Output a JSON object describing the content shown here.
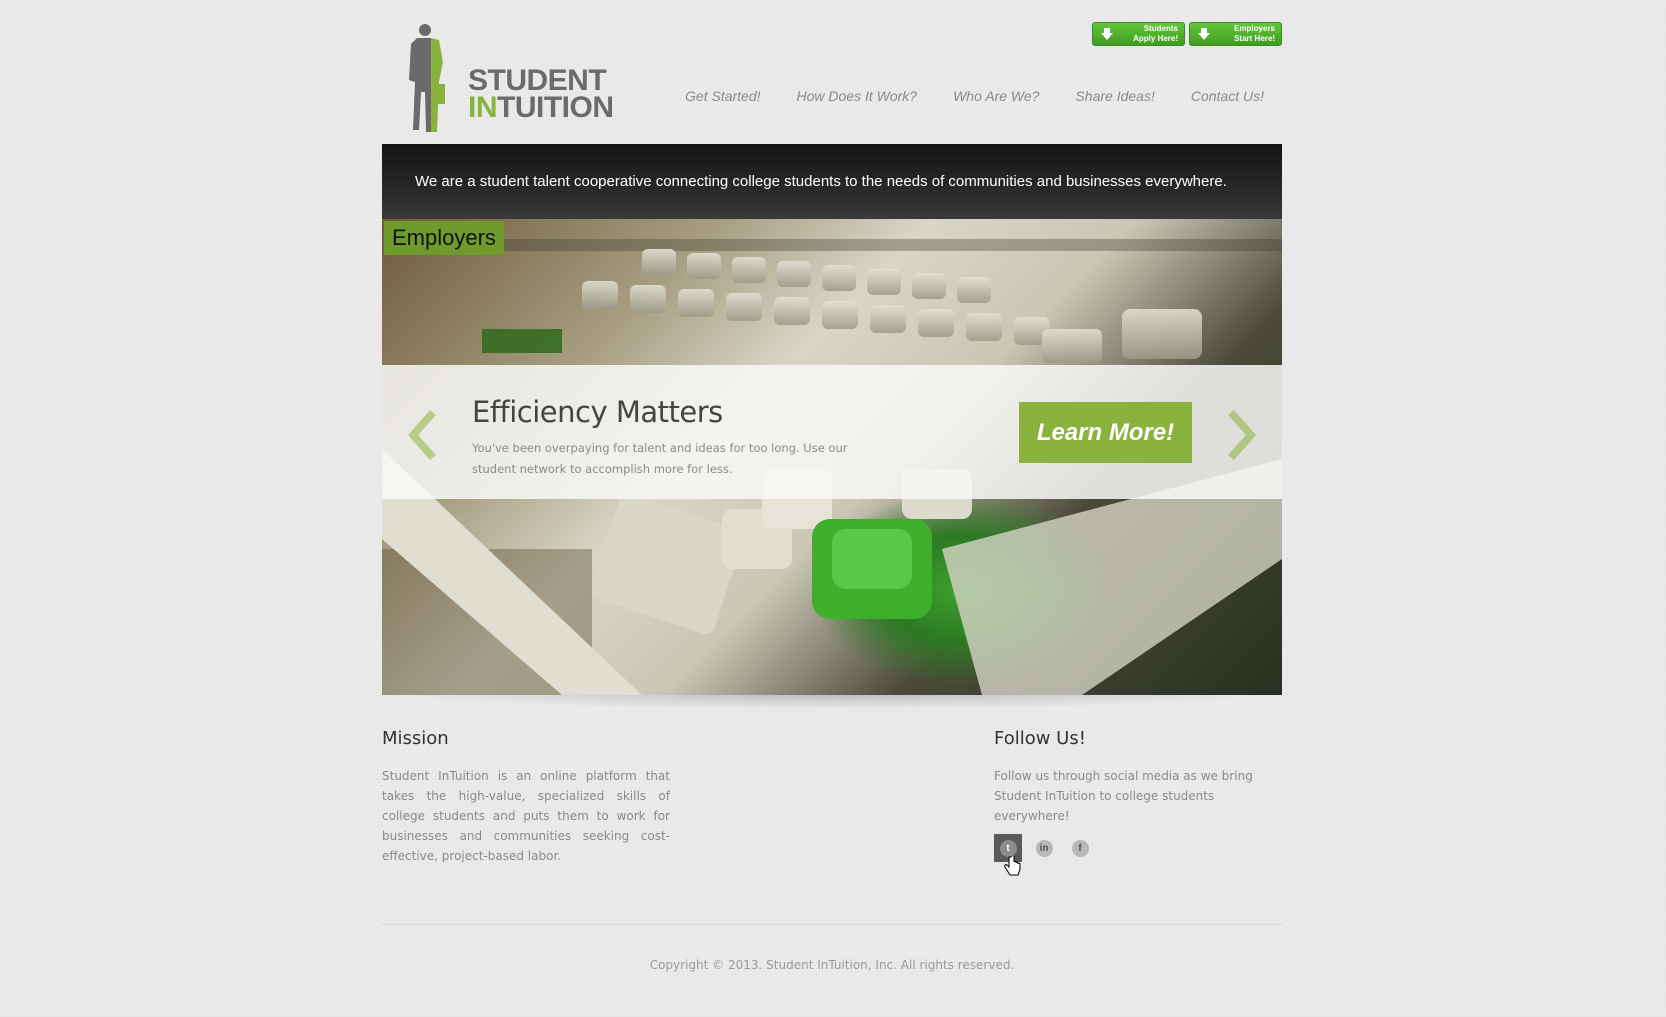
{
  "header": {
    "logo": {
      "line1": "STUDENT",
      "line2_green": "IN",
      "line2_gray": "TUITION"
    },
    "buttons": [
      {
        "line1": "Students",
        "line2": "Apply Here!"
      },
      {
        "line1": "Employers",
        "line2": "Start Here!"
      }
    ],
    "nav": [
      "Get Started!",
      "How Does It Work?",
      "Who Are We?",
      "Share Ideas!",
      "Contact Us!"
    ]
  },
  "banner": {
    "tagline": "We are a student talent cooperative connecting college students to the needs of communities and businesses everywhere."
  },
  "slider": {
    "label": "Employers",
    "title": "Efficiency Matters",
    "text": "You've been overpaying for talent and ideas for too long. Use our student network to accomplish more for less.",
    "button": "Learn More!"
  },
  "mission": {
    "heading": "Mission",
    "text": "Student InTuition is an online platform that takes the high-value, specialized skills of college students and puts them to work for businesses and communities seeking cost-effective, project-based labor."
  },
  "follow": {
    "heading": "Follow Us!",
    "text": "Follow us through social media as we bring Student InTuition to college students everywhere!",
    "icons": [
      {
        "name": "twitter-icon",
        "glyph": "t"
      },
      {
        "name": "linkedin-icon",
        "glyph": "in"
      },
      {
        "name": "facebook-icon",
        "glyph": "f"
      }
    ]
  },
  "footer": {
    "copyright": "Copyright © 2013. Student InTuition, Inc. All rights reserved."
  },
  "colors": {
    "brand_green": "#8ab33d",
    "button_green": "#4fae2c",
    "banner_dark": "#1c1c1c"
  }
}
